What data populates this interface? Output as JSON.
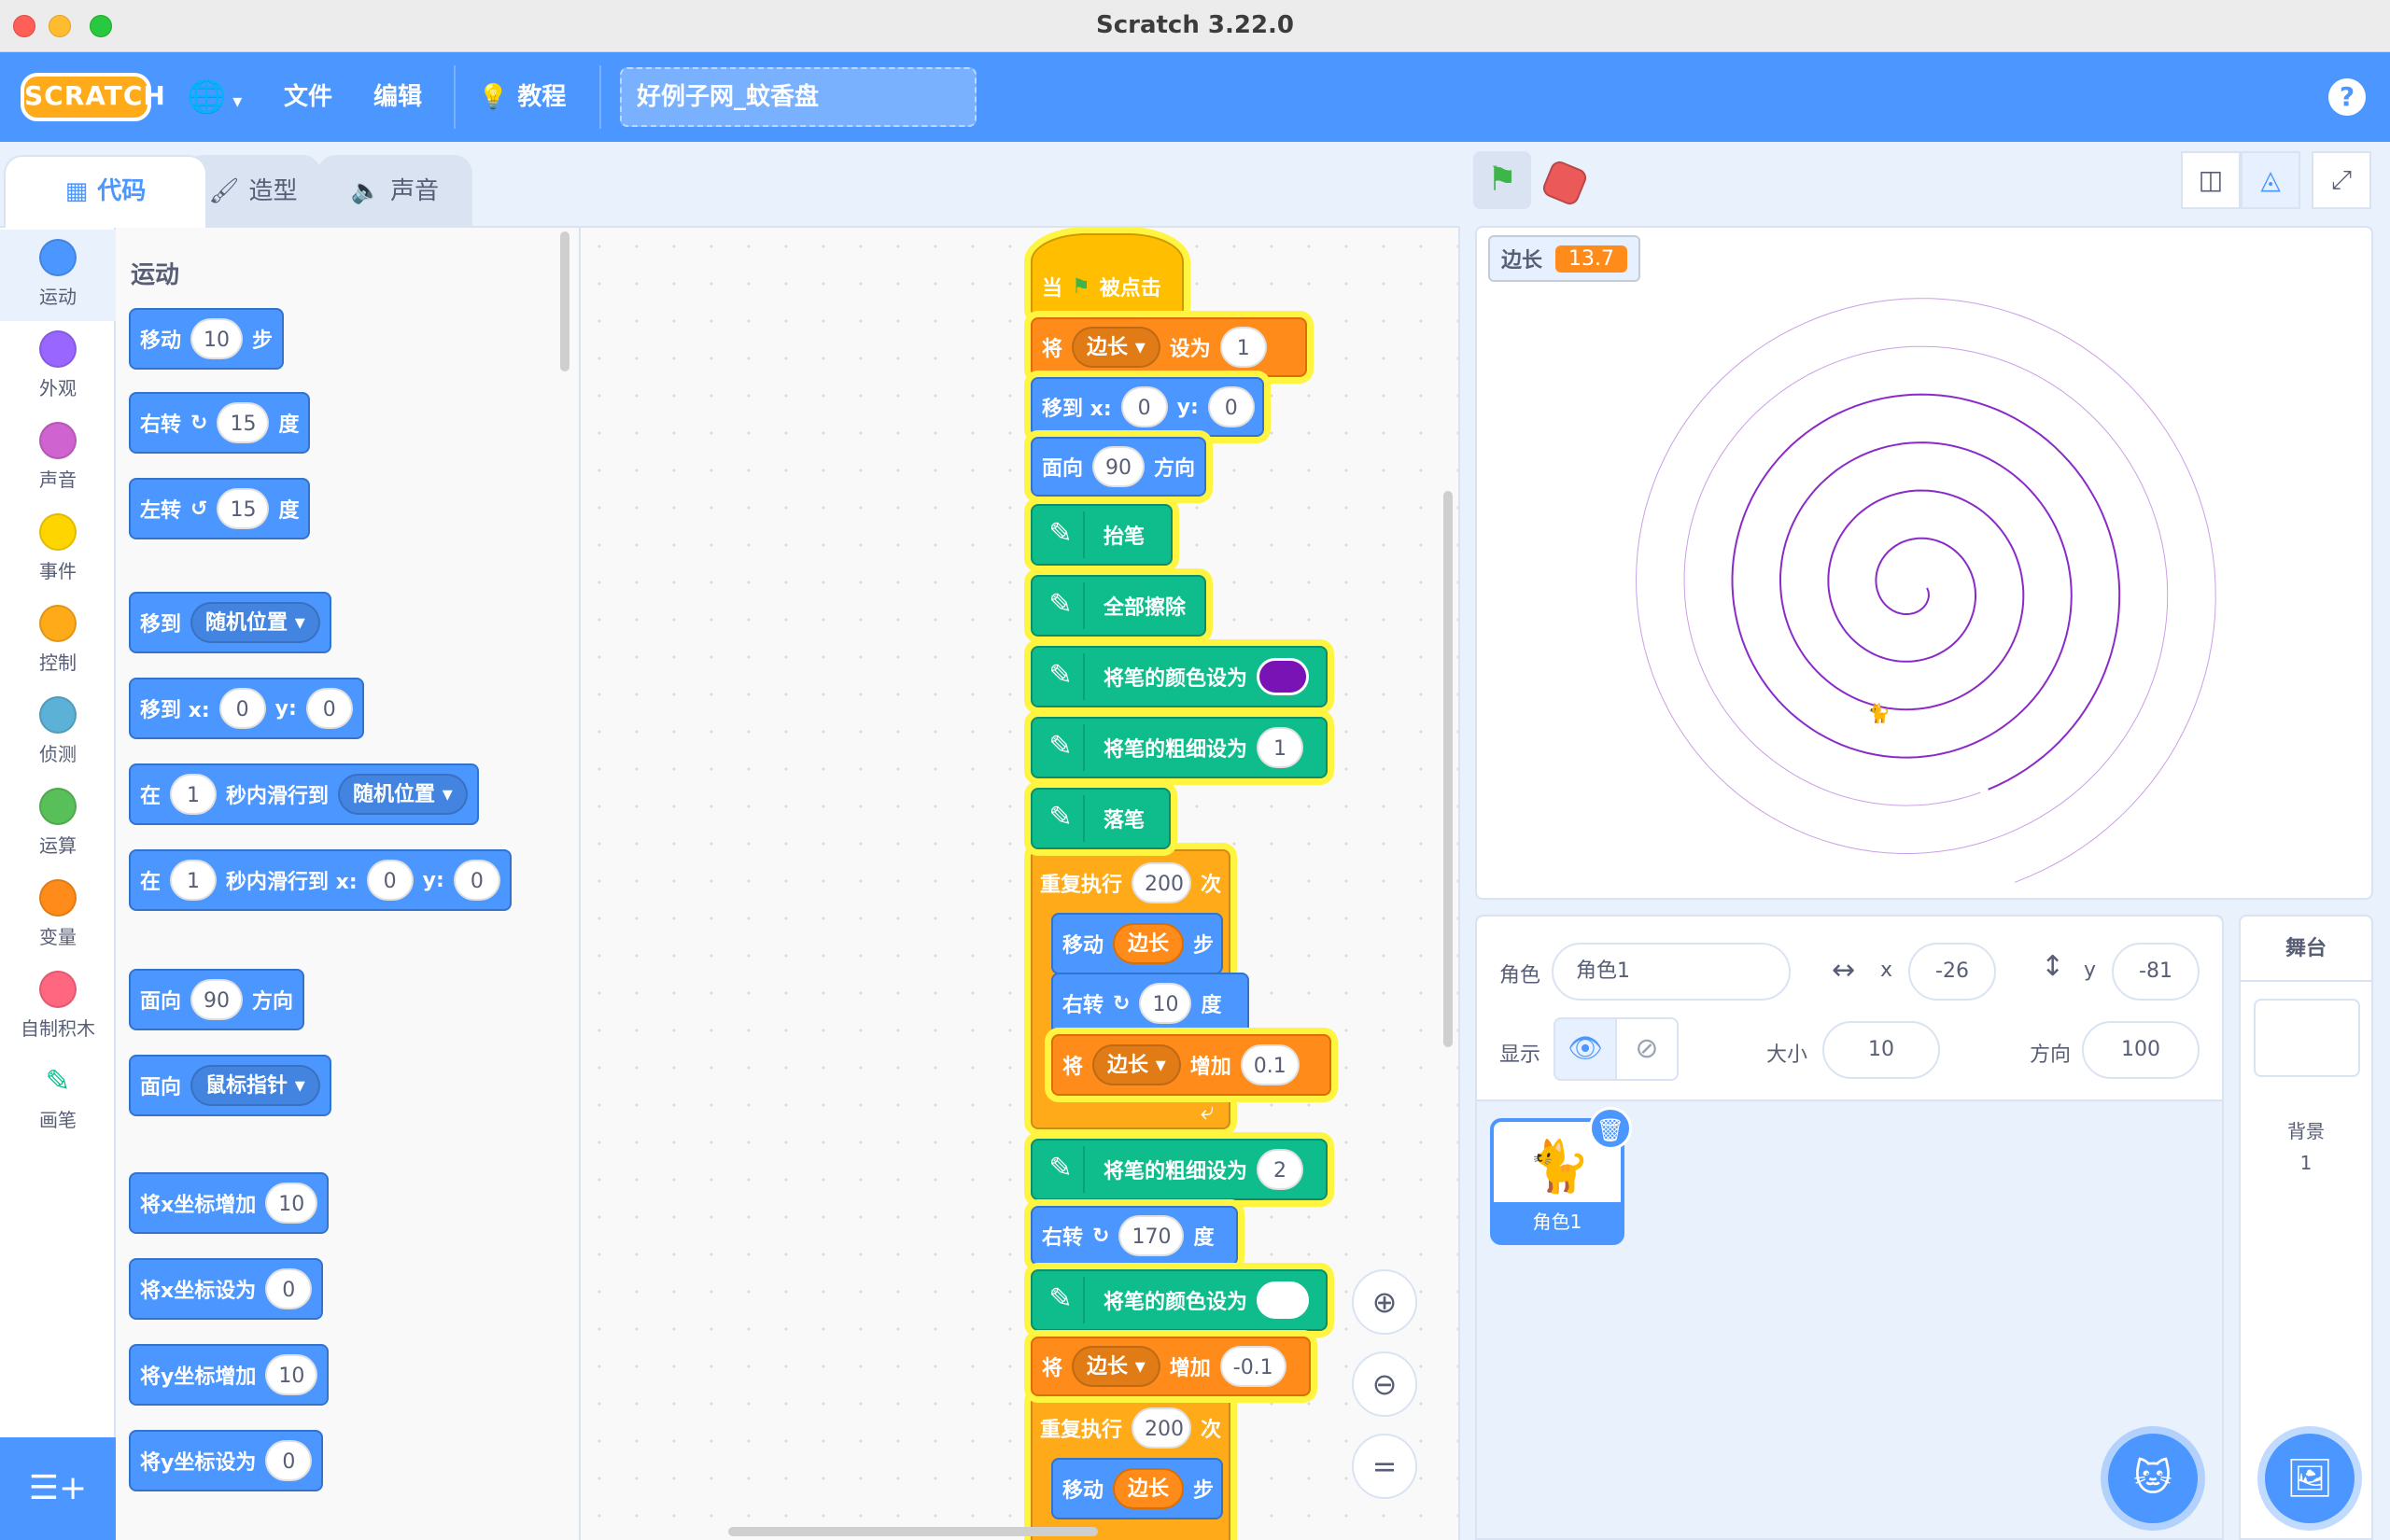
{
  "window": {
    "title": "Scratch 3.22.0"
  },
  "menubar": {
    "logo_text": "SCRATCH",
    "language_icon": "globe-icon",
    "file": "文件",
    "edit": "编辑",
    "tutorials": "教程",
    "project_title": "好例子网_蚊香盘",
    "help": "?"
  },
  "tabs": {
    "code": "代码",
    "costumes": "造型",
    "sounds": "声音"
  },
  "categories": [
    {
      "label": "运动",
      "color": "#4c97ff"
    },
    {
      "label": "外观",
      "color": "#9966ff"
    },
    {
      "label": "声音",
      "color": "#cf63cf"
    },
    {
      "label": "事件",
      "color": "#ffd500"
    },
    {
      "label": "控制",
      "color": "#ffab19"
    },
    {
      "label": "侦测",
      "color": "#5cb1d6"
    },
    {
      "label": "运算",
      "color": "#59c059"
    },
    {
      "label": "变量",
      "color": "#ff8c1a"
    },
    {
      "label": "自制积木",
      "color": "#ff6680"
    },
    {
      "label": "画笔",
      "color": "pen-icon"
    }
  ],
  "palette": {
    "heading": "运动",
    "blocks": {
      "move": {
        "a": "移动",
        "n": "10",
        "b": "步"
      },
      "turn_right": {
        "a": "右转",
        "n": "15",
        "b": "度"
      },
      "turn_left": {
        "a": "左转",
        "n": "15",
        "b": "度"
      },
      "goto": {
        "a": "移到",
        "dd": "随机位置"
      },
      "goto_xy": {
        "a": "移到 x:",
        "x": "0",
        "y_label": "y:",
        "y": "0"
      },
      "glide": {
        "a": "在",
        "n": "1",
        "b": "秒内滑行到",
        "dd": "随机位置"
      },
      "glide_xy": {
        "a": "在",
        "n": "1",
        "b": "秒内滑行到 x:",
        "x": "0",
        "y_label": "y:",
        "y": "0"
      },
      "point_dir": {
        "a": "面向",
        "n": "90",
        "b": "方向"
      },
      "point_towards": {
        "a": "面向",
        "dd": "鼠标指针"
      },
      "change_x": {
        "a": "将x坐标增加",
        "n": "10"
      },
      "set_x": {
        "a": "将x坐标设为",
        "n": "0"
      },
      "change_y": {
        "a": "将y坐标增加",
        "n": "10"
      },
      "set_y": {
        "a": "将y坐标设为",
        "n": "0"
      }
    }
  },
  "script": {
    "when_flag": {
      "a": "当",
      "b": "被点击"
    },
    "set_var": {
      "a": "将",
      "var": "边长",
      "b": "设为",
      "n": "1"
    },
    "goto_xy": {
      "a": "移到 x:",
      "x": "0",
      "y_label": "y:",
      "y": "0"
    },
    "point_dir": {
      "a": "面向",
      "n": "90",
      "b": "方向"
    },
    "pen_up": "抬笔",
    "clear": "全部擦除",
    "set_color": {
      "a": "将笔的颜色设为",
      "color": "#7a13b5"
    },
    "set_size": {
      "a": "将笔的粗细设为",
      "n": "1"
    },
    "pen_down": "落笔",
    "repeat1": {
      "a": "重复执行",
      "n": "200",
      "b": "次"
    },
    "move_var": {
      "a": "移动",
      "var": "边长",
      "b": "步"
    },
    "turn10": {
      "a": "右转",
      "n": "10",
      "b": "度"
    },
    "change_var": {
      "a": "将",
      "var": "边长",
      "b": "增加",
      "n": "0.1"
    },
    "set_size2": {
      "a": "将笔的粗细设为",
      "n": "2"
    },
    "turn170": {
      "a": "右转",
      "n": "170",
      "b": "度"
    },
    "set_color2": {
      "a": "将笔的颜色设为",
      "color": "#ffffff"
    },
    "change_var2": {
      "a": "将",
      "var": "边长",
      "b": "增加",
      "n": "-0.1"
    },
    "repeat2": {
      "a": "重复执行",
      "n": "200",
      "b": "次"
    },
    "move_var2": {
      "a": "移动",
      "var": "边长",
      "b": "步"
    }
  },
  "zoom": {
    "in": "zoom-in-icon",
    "out": "zoom-out-icon",
    "reset": "="
  },
  "stage": {
    "monitor_label": "边长",
    "monitor_value": "13.7",
    "spiral_color": "#8a2bc9"
  },
  "sprite_info": {
    "sprite_label": "角色",
    "sprite_name": "角色1",
    "x_label": "x",
    "x": "-26",
    "y_label": "y",
    "y": "-81",
    "show_label": "显示",
    "size_label": "大小",
    "size": "10",
    "direction_label": "方向",
    "direction": "100"
  },
  "sprite_list": [
    {
      "name": "角色1"
    }
  ],
  "stage_pane": {
    "title": "舞台",
    "backdrop_label": "背景",
    "backdrop_count": "1"
  }
}
